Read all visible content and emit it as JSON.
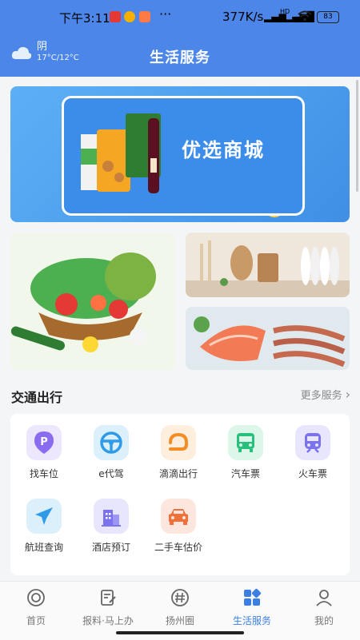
{
  "status_bar": {
    "time": "下午3:11",
    "speed": "377K/s",
    "network": "HD",
    "battery": "83"
  },
  "header": {
    "title": "生活服务",
    "weather": {
      "condition": "阴",
      "temp": "17°C/12°C",
      "icon": "cloud-icon"
    }
  },
  "banner": {
    "text": "优选商城",
    "accent": "#4b86e8"
  },
  "section": {
    "title": "交通出行",
    "more": "更多服务"
  },
  "services": [
    {
      "label": "找车位",
      "icon": "parking-icon",
      "color": "#8a6cf0",
      "bg": "#ece7fd"
    },
    {
      "label": "e代驾",
      "icon": "steering-wheel-icon",
      "color": "#2f9be8",
      "bg": "#dcf0fc"
    },
    {
      "label": "滴滴出行",
      "icon": "didi-icon",
      "color": "#f38d24",
      "bg": "#fdeedd"
    },
    {
      "label": "汽车票",
      "icon": "bus-icon",
      "color": "#27c07c",
      "bg": "#dcf6ea"
    },
    {
      "label": "火车票",
      "icon": "train-icon",
      "color": "#7b72ee",
      "bg": "#e8e6fc"
    },
    {
      "label": "航班查询",
      "icon": "airplane-icon",
      "color": "#2f9be8",
      "bg": "#dcf0fc"
    },
    {
      "label": "酒店预订",
      "icon": "hotel-icon",
      "color": "#7b72ee",
      "bg": "#e8e6fc"
    },
    {
      "label": "二手车估价",
      "icon": "car-icon",
      "color": "#f0703a",
      "bg": "#fde6dd"
    }
  ],
  "tabs": [
    {
      "label": "首页",
      "icon": "home-icon"
    },
    {
      "label": "报料·马上办",
      "icon": "report-icon"
    },
    {
      "label": "扬州圈",
      "icon": "hashtag-icon"
    },
    {
      "label": "生活服务",
      "icon": "grid-icon",
      "active": true
    },
    {
      "label": "我的",
      "icon": "user-icon"
    }
  ]
}
